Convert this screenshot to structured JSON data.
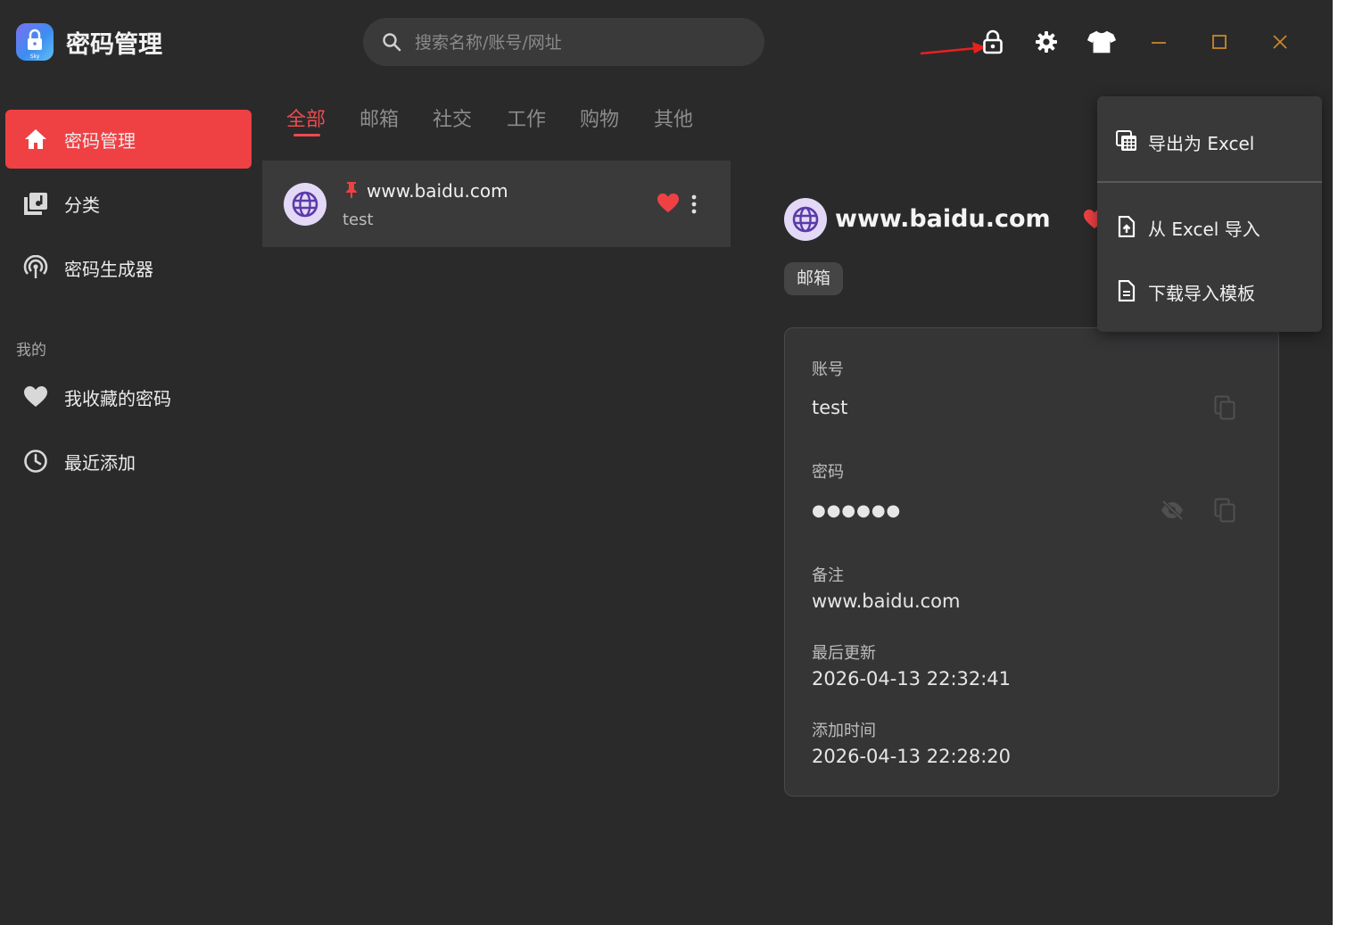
{
  "app": {
    "title": "密码管理",
    "logo_text": "Sky"
  },
  "search": {
    "placeholder": "搜索名称/账号/网址"
  },
  "sidebar": {
    "items": [
      {
        "label": "密码管理",
        "icon": "home-icon",
        "active": true
      },
      {
        "label": "分类",
        "icon": "category-icon"
      },
      {
        "label": "密码生成器",
        "icon": "generator-icon"
      }
    ],
    "section_mine": "我的",
    "mine_items": [
      {
        "label": "我收藏的密码",
        "icon": "heart-icon"
      },
      {
        "label": "最近添加",
        "icon": "clock-icon"
      }
    ]
  },
  "tabs": [
    "全部",
    "邮箱",
    "社交",
    "工作",
    "购物",
    "其他"
  ],
  "active_tab": "全部",
  "list": [
    {
      "title": "www.baidu.com",
      "account": "test",
      "pinned": true,
      "favorite": true
    }
  ],
  "detail": {
    "title": "www.baidu.com",
    "tag": "邮箱",
    "account_label": "账号",
    "account": "test",
    "password_label": "密码",
    "password_masked": "●●●●●●",
    "note_label": "备注",
    "note": "www.baidu.com",
    "updated_label": "最后更新",
    "updated": "2026-04-13 22:32:41",
    "added_label": "添加时间",
    "added": "2026-04-13 22:28:20"
  },
  "menu": {
    "items": [
      {
        "label": "导出为 Excel",
        "icon": "spreadsheet-icon"
      },
      {
        "label": "从 Excel 导入",
        "icon": "file-upload-icon"
      },
      {
        "label": "下载导入模板",
        "icon": "document-icon"
      }
    ]
  },
  "colors": {
    "accent": "#ef4144",
    "background": "#2a2a2b",
    "card": "#3a3a3b",
    "window_controls": "#c8862a"
  }
}
